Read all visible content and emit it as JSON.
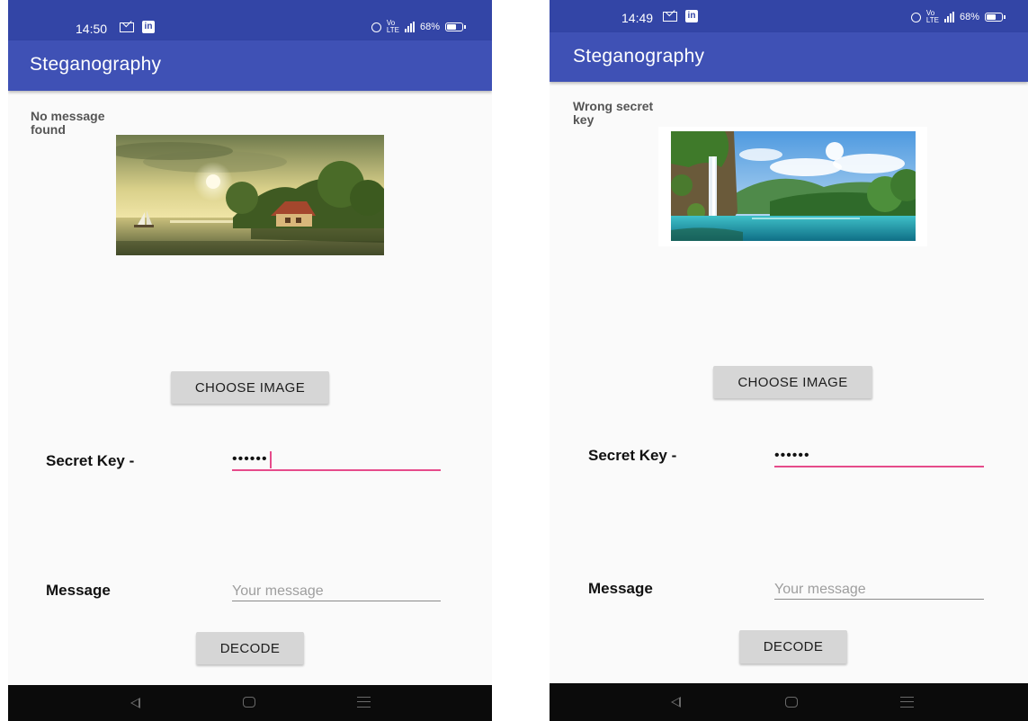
{
  "colors": {
    "status_bar": "#3345a6",
    "app_bar": "#3f51b5",
    "accent": "#e64b8a",
    "button": "#d6d6d6",
    "background": "#fafafa"
  },
  "screens": [
    {
      "status_bar": {
        "time": "14:50",
        "battery": "68%",
        "icons": [
          "gmail-icon",
          "linkedin-icon",
          "alarm-icon",
          "volte-icon",
          "signal-icon",
          "battery-icon"
        ]
      },
      "app_title": "Steganography",
      "status_message": "No message found",
      "image": {
        "subject": "lakeside-cottage-painting"
      },
      "choose_button": "CHOOSE IMAGE",
      "secret_key": {
        "label": "Secret Key -",
        "value": "••••••",
        "focused": true
      },
      "message": {
        "label": "Message",
        "placeholder": "Your message"
      },
      "decode_button": "DECODE"
    },
    {
      "status_bar": {
        "time": "14:49",
        "battery": "68%",
        "icons": [
          "gmail-icon",
          "linkedin-icon",
          "alarm-icon",
          "volte-icon",
          "signal-icon",
          "battery-icon"
        ]
      },
      "app_title": "Steganography",
      "status_message": "Wrong secret key",
      "image": {
        "subject": "waterfall-lake-photo"
      },
      "choose_button": "CHOOSE IMAGE",
      "secret_key": {
        "label": "Secret Key -",
        "value": "••••••",
        "focused": false
      },
      "message": {
        "label": "Message",
        "placeholder": "Your message"
      },
      "decode_button": "DECODE"
    }
  ]
}
